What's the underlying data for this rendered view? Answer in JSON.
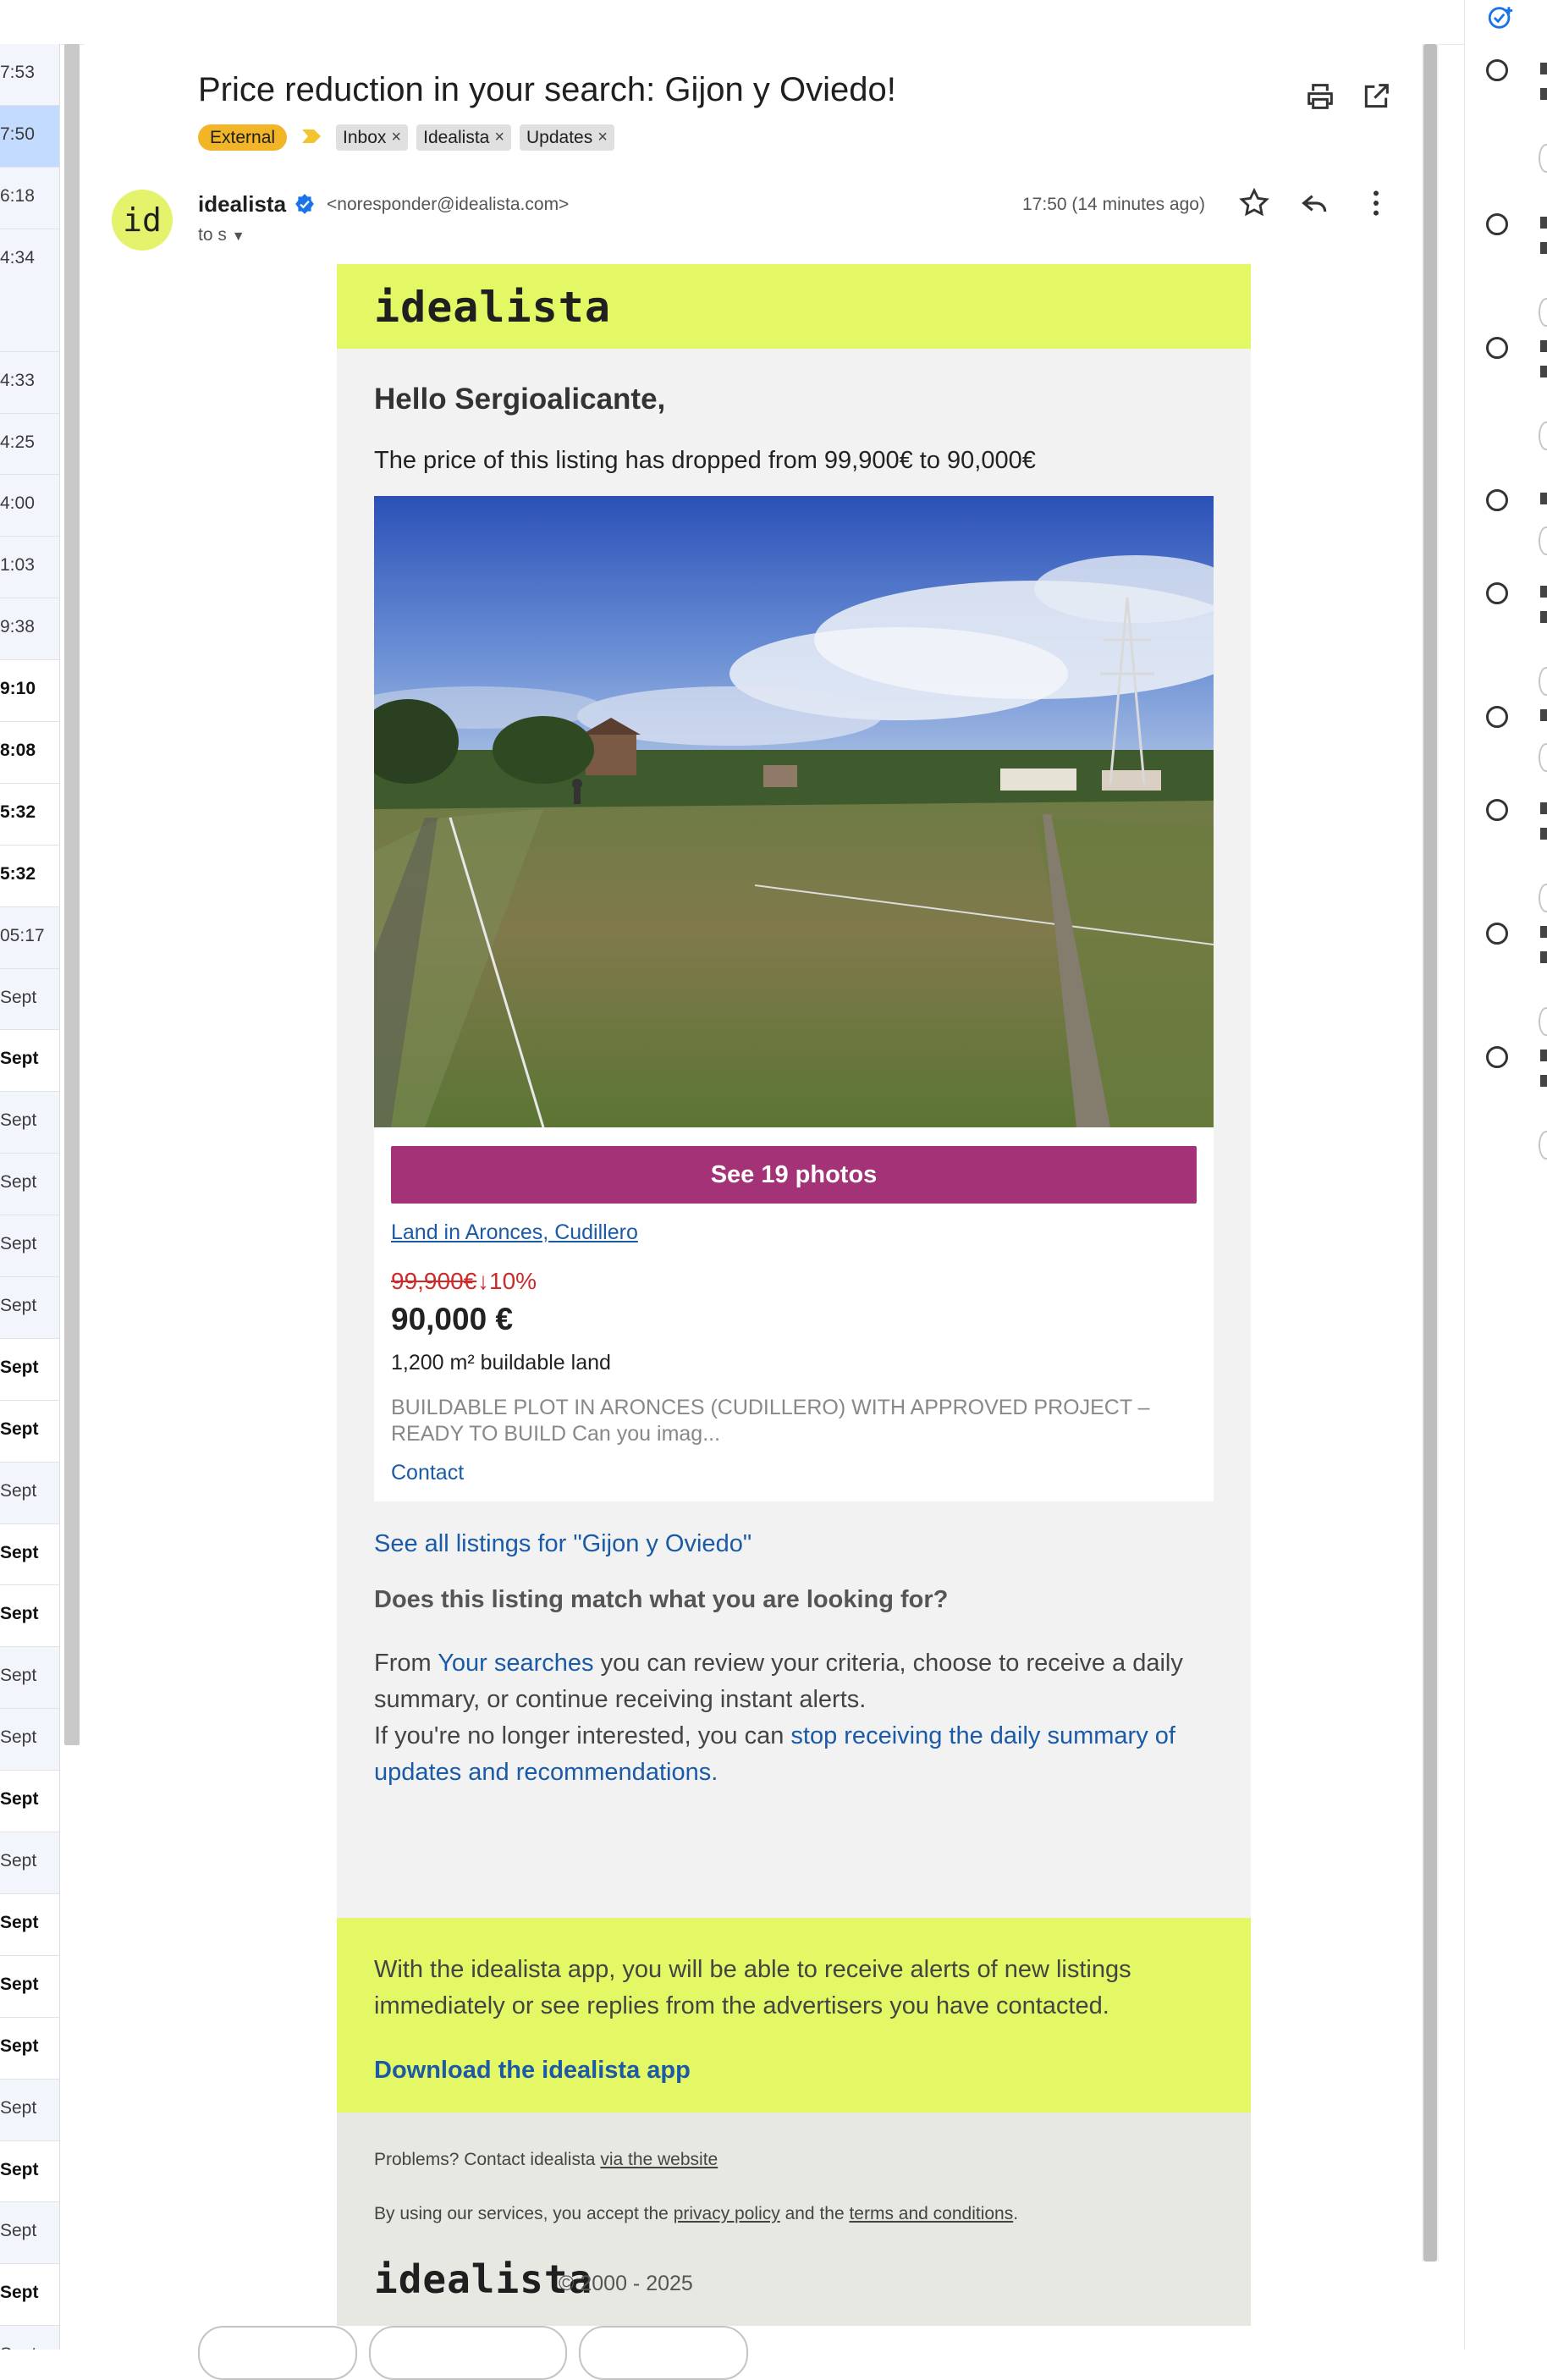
{
  "inbox_times": [
    {
      "text": "7:53",
      "style": "read"
    },
    {
      "text": "7:50",
      "style": "selected"
    },
    {
      "text": "6:18",
      "style": "read"
    },
    {
      "text": "4:34",
      "style": "read-tall"
    },
    {
      "text": "4:33",
      "style": "read"
    },
    {
      "text": "4:25",
      "style": "read"
    },
    {
      "text": "4:00",
      "style": "read"
    },
    {
      "text": "1:03",
      "style": "read"
    },
    {
      "text": "9:38",
      "style": "read"
    },
    {
      "text": "9:10",
      "style": "unread"
    },
    {
      "text": "8:08",
      "style": "unread"
    },
    {
      "text": "5:32",
      "style": "unread"
    },
    {
      "text": "5:32",
      "style": "unread"
    },
    {
      "text": "05:17",
      "style": "read"
    },
    {
      "text": "Sept",
      "style": "read"
    },
    {
      "text": "Sept",
      "style": "unread"
    },
    {
      "text": "Sept",
      "style": "read"
    },
    {
      "text": "Sept",
      "style": "read"
    },
    {
      "text": "Sept",
      "style": "read"
    },
    {
      "text": "Sept",
      "style": "read"
    },
    {
      "text": "Sept",
      "style": "unread"
    },
    {
      "text": "Sept",
      "style": "unread"
    },
    {
      "text": "Sept",
      "style": "read"
    },
    {
      "text": "Sept",
      "style": "unread"
    },
    {
      "text": "Sept",
      "style": "unread"
    },
    {
      "text": "Sept",
      "style": "read"
    },
    {
      "text": "Sept",
      "style": "read"
    },
    {
      "text": "Sept",
      "style": "unread"
    },
    {
      "text": "Sept",
      "style": "read"
    },
    {
      "text": "Sept",
      "style": "unread"
    },
    {
      "text": "Sept",
      "style": "unread"
    },
    {
      "text": "Sept",
      "style": "unread"
    },
    {
      "text": "Sept",
      "style": "read"
    },
    {
      "text": "Sept",
      "style": "unread"
    },
    {
      "text": "Sept",
      "style": "read"
    },
    {
      "text": "Sept",
      "style": "unread"
    },
    {
      "text": "Sept",
      "style": "read"
    }
  ],
  "message": {
    "subject": "Price reduction in your search: Gijon y Oviedo!",
    "labels": {
      "external": "External",
      "importance_icon": "importance-marker-icon",
      "chips": [
        "Inbox",
        "Idealista",
        "Updates"
      ]
    },
    "sender_name": "idealista",
    "sender_email": "<noresponder@idealista.com>",
    "avatar_text": "id",
    "to_line": "to s",
    "datetime": "17:50 (14 minutes ago)",
    "icons": [
      "print-icon",
      "open-in-new-window-icon",
      "star-icon",
      "reply-icon",
      "more-vert-icon",
      "verified-badge-icon"
    ]
  },
  "email": {
    "logo": "idealista",
    "greeting": "Hello Sergioalicante,",
    "drop_line": "The price of this listing has dropped from 99,900€ to 90,000€",
    "photos_button": "See 19 photos",
    "listing_link": "Land in Aronces, Cudillero",
    "old_price": "99,900€ ",
    "drop_percent": "↓10%",
    "new_price": "90,000 €",
    "area": "1,200 m² buildable land",
    "description": "BUILDABLE PLOT IN ARONCES (CUDILLERO) WITH APPROVED PROJECT – READY TO BUILD Can you imag...",
    "contact": "Contact",
    "see_all": "See all listings for \"Gijon y Oviedo\"",
    "match_question": "Does this listing match what you are looking for?",
    "para_from": "From ",
    "para_link1": "Your searches",
    "para_mid": " you can review your criteria, choose to receive a daily summary, or continue receiving instant alerts.",
    "para_line2": "If you're no longer interested, you can ",
    "para_link2": "stop receiving the daily summary of updates and recommendations.",
    "app_text": "With the idealista app, you will be able to receive alerts of new listings immediately or see replies from the advertisers you have contacted.",
    "app_download": "Download the idealista app",
    "problems_prefix": "Problems? Contact idealista ",
    "problems_link": "via the website",
    "terms_prefix": "By using our services, you accept the ",
    "terms_privacy": "privacy policy",
    "terms_and": " and the ",
    "terms_link": "terms and conditions",
    "terms_suffix": ".",
    "footer_logo": "idealista",
    "copyright": "© 2000 - 2025"
  },
  "colors": {
    "brand_yellow": "#e4f764",
    "button_magenta": "#a33276",
    "link_blue": "#1a5aa6",
    "price_red": "#cc2b2b",
    "external_chip": "#f1b527",
    "selected_row": "#c2dbff"
  },
  "tasks_panel": {
    "icons": [
      "add-task-icon",
      "task-radio-icon"
    ]
  }
}
